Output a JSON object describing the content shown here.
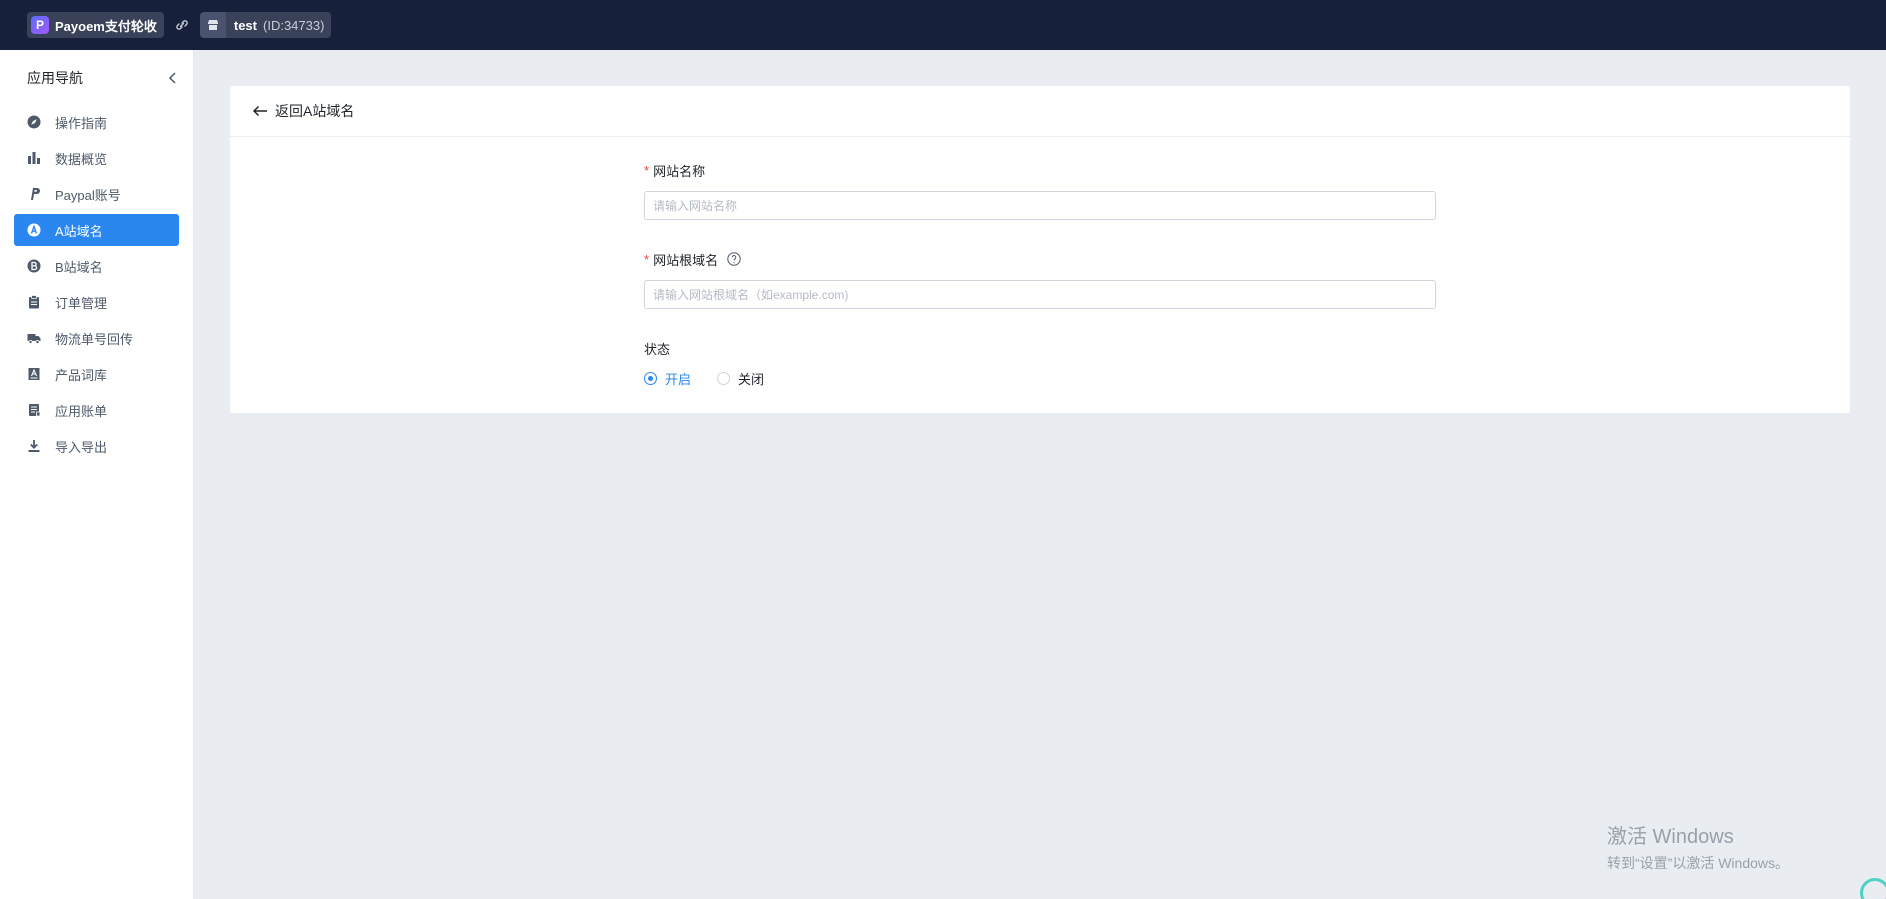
{
  "topbar": {
    "app_name": "Payoem支付轮收",
    "app_logo_letter": "P",
    "store_name": "test",
    "store_id": "(ID:34733)"
  },
  "sidebar": {
    "title": "应用导航",
    "items": [
      {
        "label": "操作指南",
        "icon": "compass-icon"
      },
      {
        "label": "数据概览",
        "icon": "bar-chart-icon"
      },
      {
        "label": "Paypal账号",
        "icon": "paypal-icon"
      },
      {
        "label": "A站域名",
        "icon": "circle-a-icon",
        "active": true
      },
      {
        "label": "B站域名",
        "icon": "circle-b-icon"
      },
      {
        "label": "订单管理",
        "icon": "clipboard-icon"
      },
      {
        "label": "物流单号回传",
        "icon": "truck-icon"
      },
      {
        "label": "产品词库",
        "icon": "lexicon-icon"
      },
      {
        "label": "应用账单",
        "icon": "receipt-icon"
      },
      {
        "label": "导入导出",
        "icon": "download-icon"
      }
    ]
  },
  "main": {
    "back_label": "返回A站域名",
    "fields": {
      "site_name": {
        "label": "网站名称",
        "placeholder": "请输入网站名称",
        "value": ""
      },
      "site_domain": {
        "label": "网站根域名",
        "placeholder": "请输入网站根域名（如example.com)",
        "value": ""
      }
    },
    "status": {
      "label": "状态",
      "options": [
        "开启",
        "关闭"
      ],
      "selected": "开启"
    }
  },
  "watermark": {
    "title": "激活 Windows",
    "subtitle": "转到“设置”以激活 Windows。"
  },
  "colors": {
    "topbar_bg": "#17203a",
    "accent": "#2b87f0",
    "required": "#f53f3f",
    "page_bg": "#e9edf2"
  }
}
